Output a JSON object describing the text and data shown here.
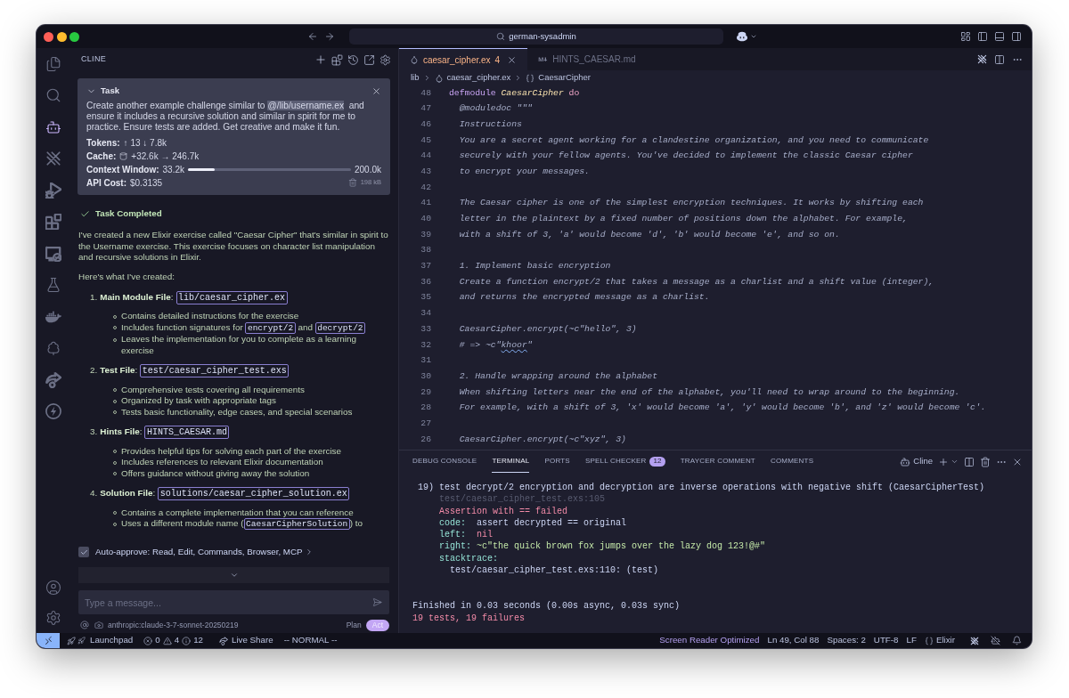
{
  "window": {
    "title": "german-sysadmin"
  },
  "activity_bar": [
    {
      "selected": false
    },
    {
      "selected": false
    },
    {
      "selected": true
    },
    {
      "selected": false
    },
    {
      "selected": false
    },
    {
      "selected": false
    },
    {
      "selected": false
    },
    {
      "selected": false
    },
    {
      "selected": false
    },
    {
      "selected": false
    },
    {
      "selected": false
    },
    {
      "selected": false
    }
  ],
  "cline": {
    "title": "CLINE",
    "task": {
      "title": "Task",
      "expanded": true,
      "text": [
        {
          "kind": "text",
          "text": "Create another example challenge similar to "
        },
        {
          "kind": "mention",
          "text": "@/lib/username.ex"
        },
        {
          "kind": "text",
          "text": "  and ensure it includes a recursive solution and similar in spirit for me to practice. Ensure tests are added. Get creative and make it fun."
        }
      ],
      "stats": [
        {
          "kind": "tokens",
          "label": "Tokens:",
          "value": "↑ 13 ↓ 7.8k"
        },
        {
          "kind": "cache",
          "label": "Cache:",
          "value": "+32.6k → 246.7k"
        },
        {
          "kind": "context",
          "label": "Context Window:",
          "value": "33.2k",
          "level": 0.166,
          "max": "200.0k"
        },
        {
          "kind": "cost",
          "label": "API Cost:",
          "value": "$0.3135",
          "size": "198 kB"
        }
      ]
    },
    "completion": {
      "title": "Task Completed",
      "paragraphs": [
        "I've created a new Elixir exercise called \"Caesar Cipher\" that's similar in spirit to the Username exercise. This exercise focuses on character list manipulation and recursive solutions in Elixir.",
        "Here's what I've created:"
      ],
      "files": [
        {
          "number": "1.",
          "heading": "**Main Module File**:",
          "path": "lib/caesar_cipher.ex",
          "bullets": [
            [
              {
                "kind": "text",
                "text": "Contains detailed instructions for the exercise"
              }
            ],
            [
              {
                "kind": "text",
                "text": "Includes function signatures for "
              },
              {
                "kind": "code",
                "text": "encrypt/2"
              },
              {
                "kind": "text",
                "text": " and "
              },
              {
                "kind": "code",
                "text": "decrypt/2"
              }
            ],
            [
              {
                "kind": "text",
                "text": "Leaves the implementation for you to complete as a learning exercise"
              }
            ]
          ]
        },
        {
          "number": "2.",
          "heading": "**Test File**:",
          "path": "test/caesar_cipher_test.exs",
          "bullets": [
            [
              {
                "kind": "text",
                "text": "Comprehensive tests covering all requirements"
              }
            ],
            [
              {
                "kind": "text",
                "text": "Organized by task with appropriate tags"
              }
            ],
            [
              {
                "kind": "text",
                "text": "Tests basic functionality, edge cases, and special scenarios"
              }
            ]
          ]
        },
        {
          "number": "3.",
          "heading": "**Hints File**:",
          "path": "HINTS_CAESAR.md",
          "bullets": [
            [
              {
                "kind": "text",
                "text": "Provides helpful tips for solving each part of the exercise"
              }
            ],
            [
              {
                "kind": "text",
                "text": "Includes references to relevant Elixir documentation"
              }
            ],
            [
              {
                "kind": "text",
                "text": "Offers guidance without giving away the solution"
              }
            ]
          ]
        },
        {
          "number": "4.",
          "heading": "**Solution File**:",
          "path": "solutions/caesar_cipher_solution.ex",
          "bullets": [
            [
              {
                "kind": "text",
                "text": "Contains a complete implementation that you can reference"
              }
            ],
            [
              {
                "kind": "text",
                "text": "Uses a different module name ("
              },
              {
                "kind": "code",
                "text": "CaesarCipherSolution"
              },
              {
                "kind": "text",
                "text": ") to"
              }
            ]
          ]
        }
      ]
    },
    "auto_approve": {
      "checked": true,
      "label": "Auto-approve: Read, Edit, Commands, Browser, MCP"
    },
    "input": {
      "placeholder": "Type a message..."
    },
    "model": "anthropic:claude-3-7-sonnet-20250219",
    "modes": [
      {
        "label": "Plan",
        "selected": false
      },
      {
        "label": "Act",
        "selected": true
      }
    ]
  },
  "editor": {
    "tabs": [
      {
        "kind": "elixir",
        "label": "caesar_cipher.ex",
        "badge": "4",
        "selected": true
      },
      {
        "kind": "markdown",
        "label": "HINTS_CAESAR.md",
        "selected": false
      }
    ],
    "breadcrumbs": [
      {
        "kind": "folder",
        "label": "lib"
      },
      {
        "kind": "elixir",
        "label": "caesar_cipher.ex"
      },
      {
        "kind": "module",
        "label": "CaesarCipher"
      }
    ],
    "lines": [
      {
        "number": "48",
        "segments": [
          {
            "kind": "keyword",
            "text": "defmodule "
          },
          {
            "kind": "module",
            "text": "CaesarCipher "
          },
          {
            "kind": "block",
            "text": "do"
          }
        ]
      },
      {
        "number": "47",
        "segments": [
          {
            "kind": "doc",
            "text": "  @moduledoc \"\"\""
          }
        ]
      },
      {
        "number": "46",
        "segments": [
          {
            "kind": "doc",
            "text": "  Instructions"
          }
        ]
      },
      {
        "number": "45",
        "segments": [
          {
            "kind": "doc",
            "text": "  You are a secret agent working for a clandestine organization, and you need to communicate"
          }
        ]
      },
      {
        "number": "44",
        "segments": [
          {
            "kind": "doc",
            "text": "  securely with your fellow agents. You've decided to implement the classic Caesar cipher"
          }
        ]
      },
      {
        "number": "43",
        "segments": [
          {
            "kind": "doc",
            "text": "  to encrypt your messages."
          }
        ]
      },
      {
        "number": "42"
      },
      {
        "number": "41",
        "segments": [
          {
            "kind": "doc",
            "text": "  The Caesar cipher is one of the simplest encryption techniques. It works by shifting each"
          }
        ]
      },
      {
        "number": "40",
        "segments": [
          {
            "kind": "doc",
            "text": "  letter in the plaintext by a fixed number of positions down the alphabet. For example,"
          }
        ]
      },
      {
        "number": "39",
        "segments": [
          {
            "kind": "doc",
            "text": "  with a shift of 3, 'a' would become 'd', 'b' would become 'e', and so on."
          }
        ]
      },
      {
        "number": "38"
      },
      {
        "number": "37",
        "segments": [
          {
            "kind": "doc",
            "text": "  1. Implement basic encryption"
          }
        ]
      },
      {
        "number": "36",
        "segments": [
          {
            "kind": "doc",
            "text": "  Create a function encrypt/2 that takes a message as a charlist and a shift value (integer),"
          }
        ]
      },
      {
        "number": "35",
        "segments": [
          {
            "kind": "doc",
            "text": "  and returns the encrypted message as a charlist."
          }
        ]
      },
      {
        "number": "34"
      },
      {
        "number": "33",
        "segments": [
          {
            "kind": "doc",
            "text": "  CaesarCipher.encrypt(~c\"hello\", 3)"
          }
        ]
      },
      {
        "number": "32",
        "segments": [
          {
            "kind": "doc",
            "text": "  # => ~c\""
          },
          {
            "kind": "misspelled",
            "text": "khoor"
          },
          {
            "kind": "doc",
            "text": "\""
          }
        ]
      },
      {
        "number": "31"
      },
      {
        "number": "30",
        "segments": [
          {
            "kind": "doc",
            "text": "  2. Handle wrapping around the alphabet"
          }
        ]
      },
      {
        "number": "29",
        "segments": [
          {
            "kind": "doc",
            "text": "  When shifting letters near the end of the alphabet, you'll need to wrap around to the beginning."
          }
        ]
      },
      {
        "number": "28",
        "segments": [
          {
            "kind": "doc",
            "text": "  For example, with a shift of 3, 'x' would become 'a', 'y' would become 'b', and 'z' would become 'c'."
          }
        ]
      },
      {
        "number": "27"
      },
      {
        "number": "26",
        "segments": [
          {
            "kind": "doc",
            "text": "  CaesarCipher.encrypt(~c\"xyz\", 3)"
          }
        ]
      }
    ]
  },
  "panel": {
    "tabs": [
      {
        "label": "DEBUG CONSOLE",
        "selected": false
      },
      {
        "label": "TERMINAL",
        "selected": true
      },
      {
        "label": "PORTS",
        "selected": false
      },
      {
        "label": "SPELL CHECKER",
        "badge": "12",
        "selected": false
      },
      {
        "label": "TRAYCER COMMENT",
        "selected": false
      },
      {
        "label": "COMMENTS",
        "selected": false
      }
    ],
    "terminal": {
      "name": "Cline",
      "blocks": [
        {
          "lines": [
            {
              "segments": [
                {
                  "kind": "plain",
                  "text": " 19) test decrypt/2 encryption and decryption are inverse operations with negative shift (CaesarCipherTest)"
                }
              ]
            },
            {
              "segments": [
                {
                  "kind": "muted",
                  "text": "     test/caesar_cipher_test.exs:105"
                }
              ]
            },
            {
              "segments": [
                {
                  "kind": "error",
                  "text": "     Assertion with == failed"
                }
              ]
            },
            {
              "segments": [
                {
                  "kind": "label",
                  "text": "     code:"
                },
                {
                  "kind": "plain",
                  "text": "  assert decrypted == original"
                }
              ]
            },
            {
              "segments": [
                {
                  "kind": "label",
                  "text": "     left:"
                },
                {
                  "kind": "error",
                  "text": "  nil"
                }
              ]
            },
            {
              "segments": [
                {
                  "kind": "label",
                  "text": "     right:"
                },
                {
                  "kind": "string",
                  "text": " ~c\"the quick brown fox jumps over the lazy dog 123!@#\""
                }
              ]
            },
            {
              "segments": [
                {
                  "kind": "label",
                  "text": "     stacktrace:"
                }
              ]
            },
            {
              "segments": [
                {
                  "kind": "plain",
                  "text": "       test/caesar_cipher_test.exs:110: (test)"
                }
              ]
            }
          ]
        },
        {
          "lines": [
            {
              "segments": [
                {
                  "kind": "plain",
                  "text": "Finished in 0.03 seconds (0.00s async, 0.03s sync)"
                }
              ]
            },
            {
              "segments": [
                {
                  "kind": "error",
                  "text": "19 tests, 19 failures"
                }
              ]
            }
          ]
        }
      ]
    }
  },
  "status_bar": {
    "launchpad": "Launchpad",
    "problems": {
      "errors": "0",
      "warnings": "4",
      "infos": "12"
    },
    "live_share": "Live Share",
    "vim_mode": "-- NORMAL --",
    "right": [
      {
        "kind": "accent",
        "text": "Screen Reader Optimized"
      },
      {
        "kind": "plain",
        "text": "Ln 49, Col 88"
      },
      {
        "kind": "plain",
        "text": "Spaces: 2"
      },
      {
        "kind": "plain",
        "text": "UTF-8"
      },
      {
        "kind": "plain",
        "text": "LF"
      },
      {
        "kind": "language",
        "text": "Elixir"
      }
    ]
  }
}
